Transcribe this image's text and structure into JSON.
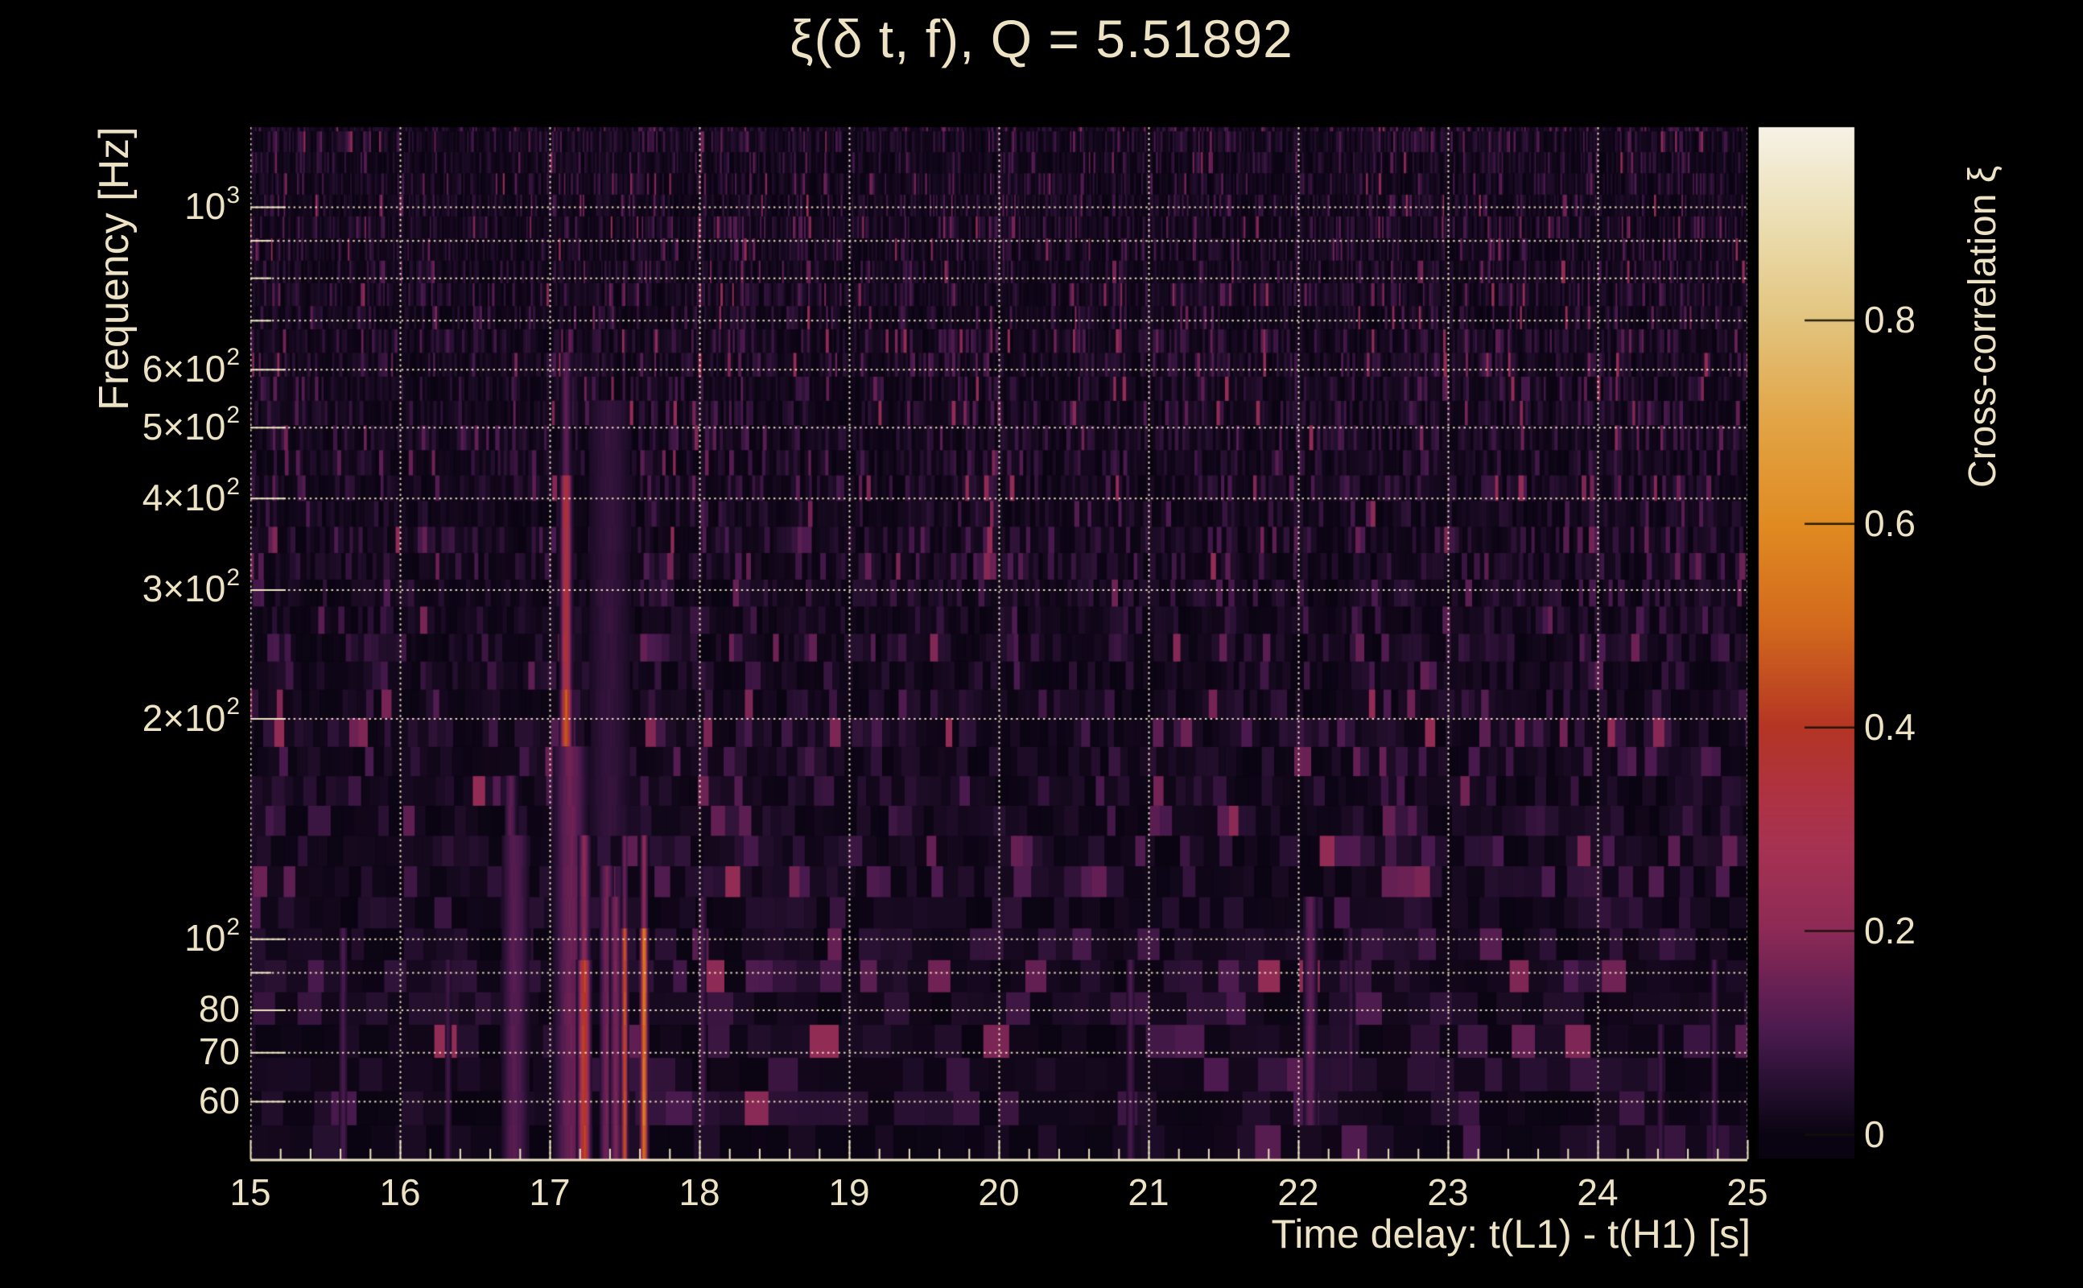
{
  "figure": {
    "background_color": "#000000",
    "text_color": "#ede3c4",
    "grid_color": "#f2e7c4"
  },
  "chart_data": {
    "type": "heatmap",
    "title": "ξ(δ t, f), Q = 5.51892",
    "xlabel": "Time delay: t(L1) - t(H1) [s]",
    "ylabel": "Frequency [Hz]",
    "x_range": [
      15,
      25
    ],
    "x_ticks": [
      15,
      16,
      17,
      18,
      19,
      20,
      21,
      22,
      23,
      24,
      25
    ],
    "x_minor_tick_step": 0.2,
    "y_scale": "log",
    "y_range_hz": [
      50,
      1285
    ],
    "y_tick_labels": [
      {
        "f": 1000,
        "main": "10",
        "sup": "3"
      },
      {
        "f": 600,
        "main": "6×10",
        "sup": "2"
      },
      {
        "f": 500,
        "main": "5×10",
        "sup": "2"
      },
      {
        "f": 400,
        "main": "4×10",
        "sup": "2"
      },
      {
        "f": 300,
        "main": "3×10",
        "sup": "2"
      },
      {
        "f": 200,
        "main": "2×10",
        "sup": "2"
      },
      {
        "f": 100,
        "main": "10",
        "sup": "2"
      },
      {
        "f": 80,
        "main": "80"
      },
      {
        "f": 70,
        "main": "70"
      },
      {
        "f": 60,
        "main": "60"
      }
    ],
    "y_gridlines_hz": [
      60,
      70,
      80,
      90,
      100,
      200,
      300,
      400,
      500,
      600,
      700,
      800,
      900,
      1000
    ],
    "grid": true,
    "colorbar": {
      "label": "Cross-correlation ξ",
      "tick_values": [
        0,
        0.2,
        0.4,
        0.6,
        0.8
      ],
      "tick_labels": [
        "0",
        "0.2",
        "0.4",
        "0.6",
        "0.8"
      ],
      "value_range": [
        -0.02,
        0.99
      ],
      "colormap_stops": [
        [
          0.0,
          "#0a0412"
        ],
        [
          0.05,
          "#271031"
        ],
        [
          0.1,
          "#4a1a4e"
        ],
        [
          0.15,
          "#6b2154"
        ],
        [
          0.2,
          "#8c2a55"
        ],
        [
          0.28,
          "#a63253"
        ],
        [
          0.34,
          "#ae3240"
        ],
        [
          0.4,
          "#b43524"
        ],
        [
          0.5,
          "#d2691d"
        ],
        [
          0.6,
          "#e08b22"
        ],
        [
          0.7,
          "#e2a445"
        ],
        [
          0.8,
          "#e2c47e"
        ],
        [
          0.9,
          "#ecdfb4"
        ],
        [
          1.0,
          "#f7f4ec"
        ]
      ]
    },
    "noise_floor": {
      "mean_value": 0.028,
      "max_value": 0.22,
      "description": "dark purple tiled time-frequency noise, tiles wider at low frequency"
    },
    "features": [
      {
        "t": 15.62,
        "sigma_s": 0.015,
        "segments": [
          [
            50,
            100,
            0.1
          ]
        ]
      },
      {
        "t": 16.32,
        "sigma_s": 0.012,
        "segments": [
          [
            50,
            90,
            0.09
          ]
        ]
      },
      {
        "t": 16.74,
        "sigma_s": 0.022,
        "segments": [
          [
            50,
            66,
            0.4
          ],
          [
            66,
            100,
            0.22
          ],
          [
            100,
            170,
            0.13
          ]
        ]
      },
      {
        "t": 16.77,
        "sigma_s": 0.05,
        "segments": [
          [
            50,
            140,
            0.12
          ]
        ]
      },
      {
        "t": 17.11,
        "sigma_s": 0.018,
        "segments": [
          [
            50,
            80,
            0.62
          ],
          [
            80,
            160,
            0.76
          ],
          [
            160,
            210,
            0.5
          ],
          [
            210,
            430,
            0.36
          ],
          [
            430,
            620,
            0.13
          ]
        ]
      },
      {
        "t": 17.14,
        "sigma_s": 0.06,
        "segments": [
          [
            50,
            180,
            0.15
          ]
        ]
      },
      {
        "t": 17.23,
        "sigma_s": 0.02,
        "segments": [
          [
            50,
            92,
            0.42
          ],
          [
            92,
            135,
            0.2
          ]
        ]
      },
      {
        "t": 17.38,
        "sigma_s": 0.025,
        "segments": [
          [
            50,
            130,
            0.16
          ]
        ]
      },
      {
        "t": 17.44,
        "sigma_s": 0.02,
        "segments": [
          [
            50,
            115,
            0.17
          ]
        ]
      },
      {
        "t": 17.5,
        "sigma_s": 0.01,
        "segments": [
          [
            50,
            105,
            0.46
          ],
          [
            105,
            150,
            0.16
          ]
        ]
      },
      {
        "t": 17.63,
        "sigma_s": 0.012,
        "segments": [
          [
            50,
            108,
            0.58
          ],
          [
            108,
            145,
            0.22
          ]
        ]
      },
      {
        "t": 17.4,
        "sigma_s": 0.09,
        "segments": [
          [
            140,
            560,
            0.07
          ]
        ]
      },
      {
        "t": 18.02,
        "sigma_s": 0.015,
        "segments": [
          [
            55,
            110,
            0.1
          ]
        ]
      },
      {
        "t": 20.88,
        "sigma_s": 0.015,
        "segments": [
          [
            50,
            95,
            0.1
          ]
        ]
      },
      {
        "t": 22.08,
        "sigma_s": 0.025,
        "segments": [
          [
            55,
            115,
            0.13
          ]
        ]
      },
      {
        "t": 22.35,
        "sigma_s": 0.012,
        "segments": [
          [
            60,
            100,
            0.08
          ]
        ]
      },
      {
        "t": 24.42,
        "sigma_s": 0.012,
        "segments": [
          [
            50,
            80,
            0.09
          ]
        ]
      },
      {
        "t": 24.78,
        "sigma_s": 0.012,
        "segments": [
          [
            50,
            90,
            0.1
          ]
        ]
      }
    ]
  }
}
